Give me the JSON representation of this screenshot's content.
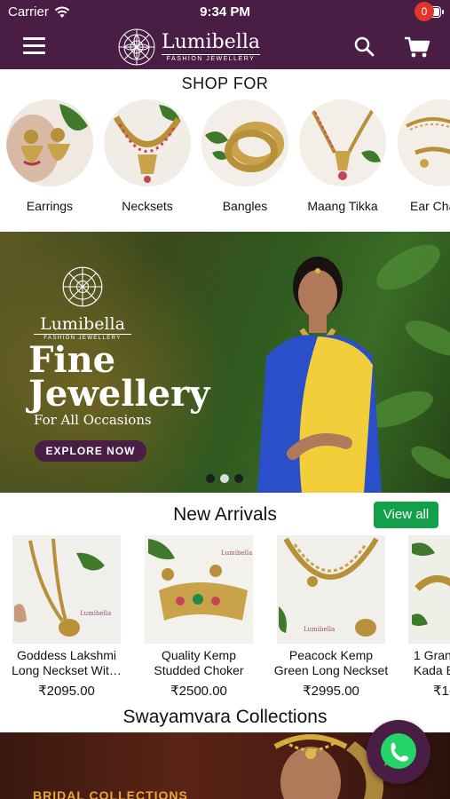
{
  "status_bar": {
    "carrier": "Carrier",
    "time": "9:34 PM",
    "battery_level": 1.0
  },
  "header": {
    "logo_name": "Lumibella",
    "logo_tagline": "FASHION JEWELLERY",
    "cart_count": "0",
    "icons": {
      "menu": "hamburger-icon",
      "search": "search-icon",
      "cart": "cart-icon"
    }
  },
  "shop_for": {
    "title": "SHOP FOR",
    "categories": [
      {
        "label": "Earrings"
      },
      {
        "label": "Necksets"
      },
      {
        "label": "Bangles"
      },
      {
        "label": "Maang Tikka"
      },
      {
        "label": "Ear Cha"
      }
    ]
  },
  "banner": {
    "logo_name": "Lumibella",
    "logo_tagline": "FASHION JEWELLERY",
    "headline_line1": "Fine",
    "headline_line2": "Jewellery",
    "subline": "For All Occasions",
    "cta": "EXPLORE NOW",
    "active_slide": 1,
    "slide_count": 3
  },
  "new_arrivals": {
    "title": "New Arrivals",
    "view_all": "View all",
    "products": [
      {
        "name_line1": "Goddess Lakshmi",
        "name_line2": "Long Neckset Wit…",
        "price": "₹2095.00",
        "watermark": "Lumibella"
      },
      {
        "name_line1": "Quality Kemp",
        "name_line2": "Studded Choker",
        "price": "₹2500.00",
        "watermark": "Lumibella"
      },
      {
        "name_line1": "Peacock Kemp",
        "name_line2": "Green Long Neckset",
        "price": "₹2995.00",
        "watermark": "Lumibella"
      },
      {
        "name_line1": "1 Gran",
        "name_line2": "Kada B",
        "price": "₹1-"
      }
    ]
  },
  "swayamvara": {
    "title": "Swayamvara Collections",
    "banner_label": "BRIDAL COLLECTIONS"
  },
  "colors": {
    "brand": "#4a1d45",
    "accent_green": "#12a14a",
    "badge_red": "#e0352b"
  },
  "floating": {
    "whatsapp": "whatsapp-icon"
  }
}
